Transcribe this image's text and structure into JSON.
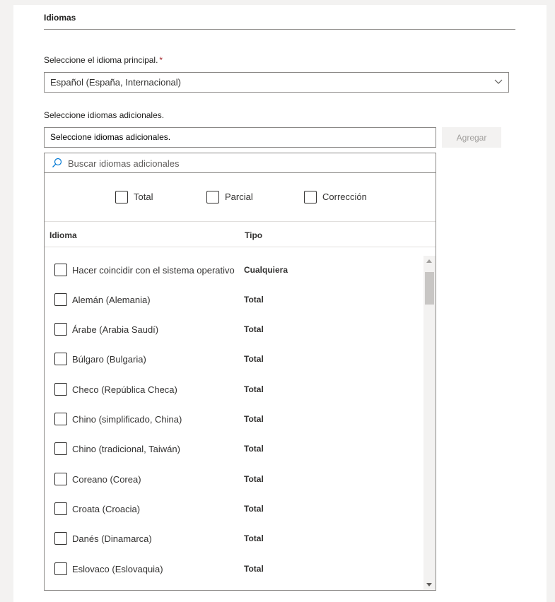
{
  "section": {
    "title": "Idiomas"
  },
  "primary": {
    "label": "Seleccione el idioma principal.",
    "required_mark": "*",
    "selected": "Español (España, Internacional)"
  },
  "additional": {
    "label": "Seleccione idiomas adicionales.",
    "input_value": "Seleccione idiomas adicionales.",
    "add_button": "Agregar",
    "search_placeholder": "Buscar idiomas adicionales",
    "filters": [
      {
        "label": "Total"
      },
      {
        "label": "Parcial"
      },
      {
        "label": "Corrección"
      }
    ],
    "columns": {
      "language": "Idioma",
      "type": "Tipo"
    },
    "rows": [
      {
        "name": "Hacer coincidir con el sistema operativo",
        "type": "Cualquiera"
      },
      {
        "name": "Alemán (Alemania)",
        "type": "Total"
      },
      {
        "name": "Árabe (Arabia Saudí)",
        "type": "Total"
      },
      {
        "name": "Búlgaro (Bulgaria)",
        "type": "Total"
      },
      {
        "name": "Checo (República Checa)",
        "type": "Total"
      },
      {
        "name": "Chino (simplificado, China)",
        "type": "Total"
      },
      {
        "name": "Chino (tradicional, Taiwán)",
        "type": "Total"
      },
      {
        "name": "Coreano (Corea)",
        "type": "Total"
      },
      {
        "name": "Croata (Croacia)",
        "type": "Total"
      },
      {
        "name": "Danés (Dinamarca)",
        "type": "Total"
      },
      {
        "name": "Eslovaco (Eslovaquia)",
        "type": "Total"
      }
    ]
  },
  "icons": {
    "dropdown": "chevron-down-icon",
    "search": "search-icon"
  },
  "colors": {
    "border": "#8a8886",
    "required": "#a4262c",
    "disabled_button_bg": "#f3f2f1",
    "disabled_button_text": "#a19f9d"
  }
}
